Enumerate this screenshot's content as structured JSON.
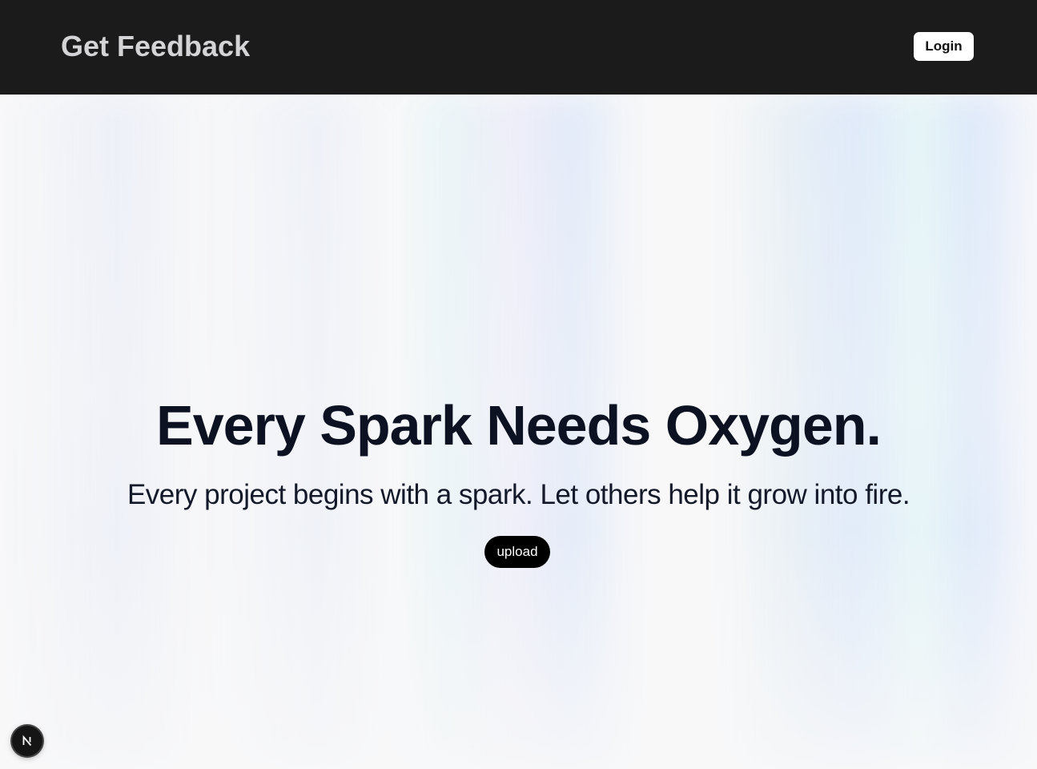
{
  "header": {
    "brand": "Get Feedback",
    "login_label": "Login"
  },
  "hero": {
    "headline": "Every Spark Needs Oxygen.",
    "subheadline": "Every project begins with a spark. Let others help it grow into fire.",
    "upload_label": "upload"
  },
  "dev_indicator": {
    "icon": "nextjs-logo-icon"
  },
  "colors": {
    "header_bg": "#1b1b1b",
    "brand_text": "#d4d4d6",
    "headline_text": "#0c1222",
    "upload_bg": "#000000"
  }
}
